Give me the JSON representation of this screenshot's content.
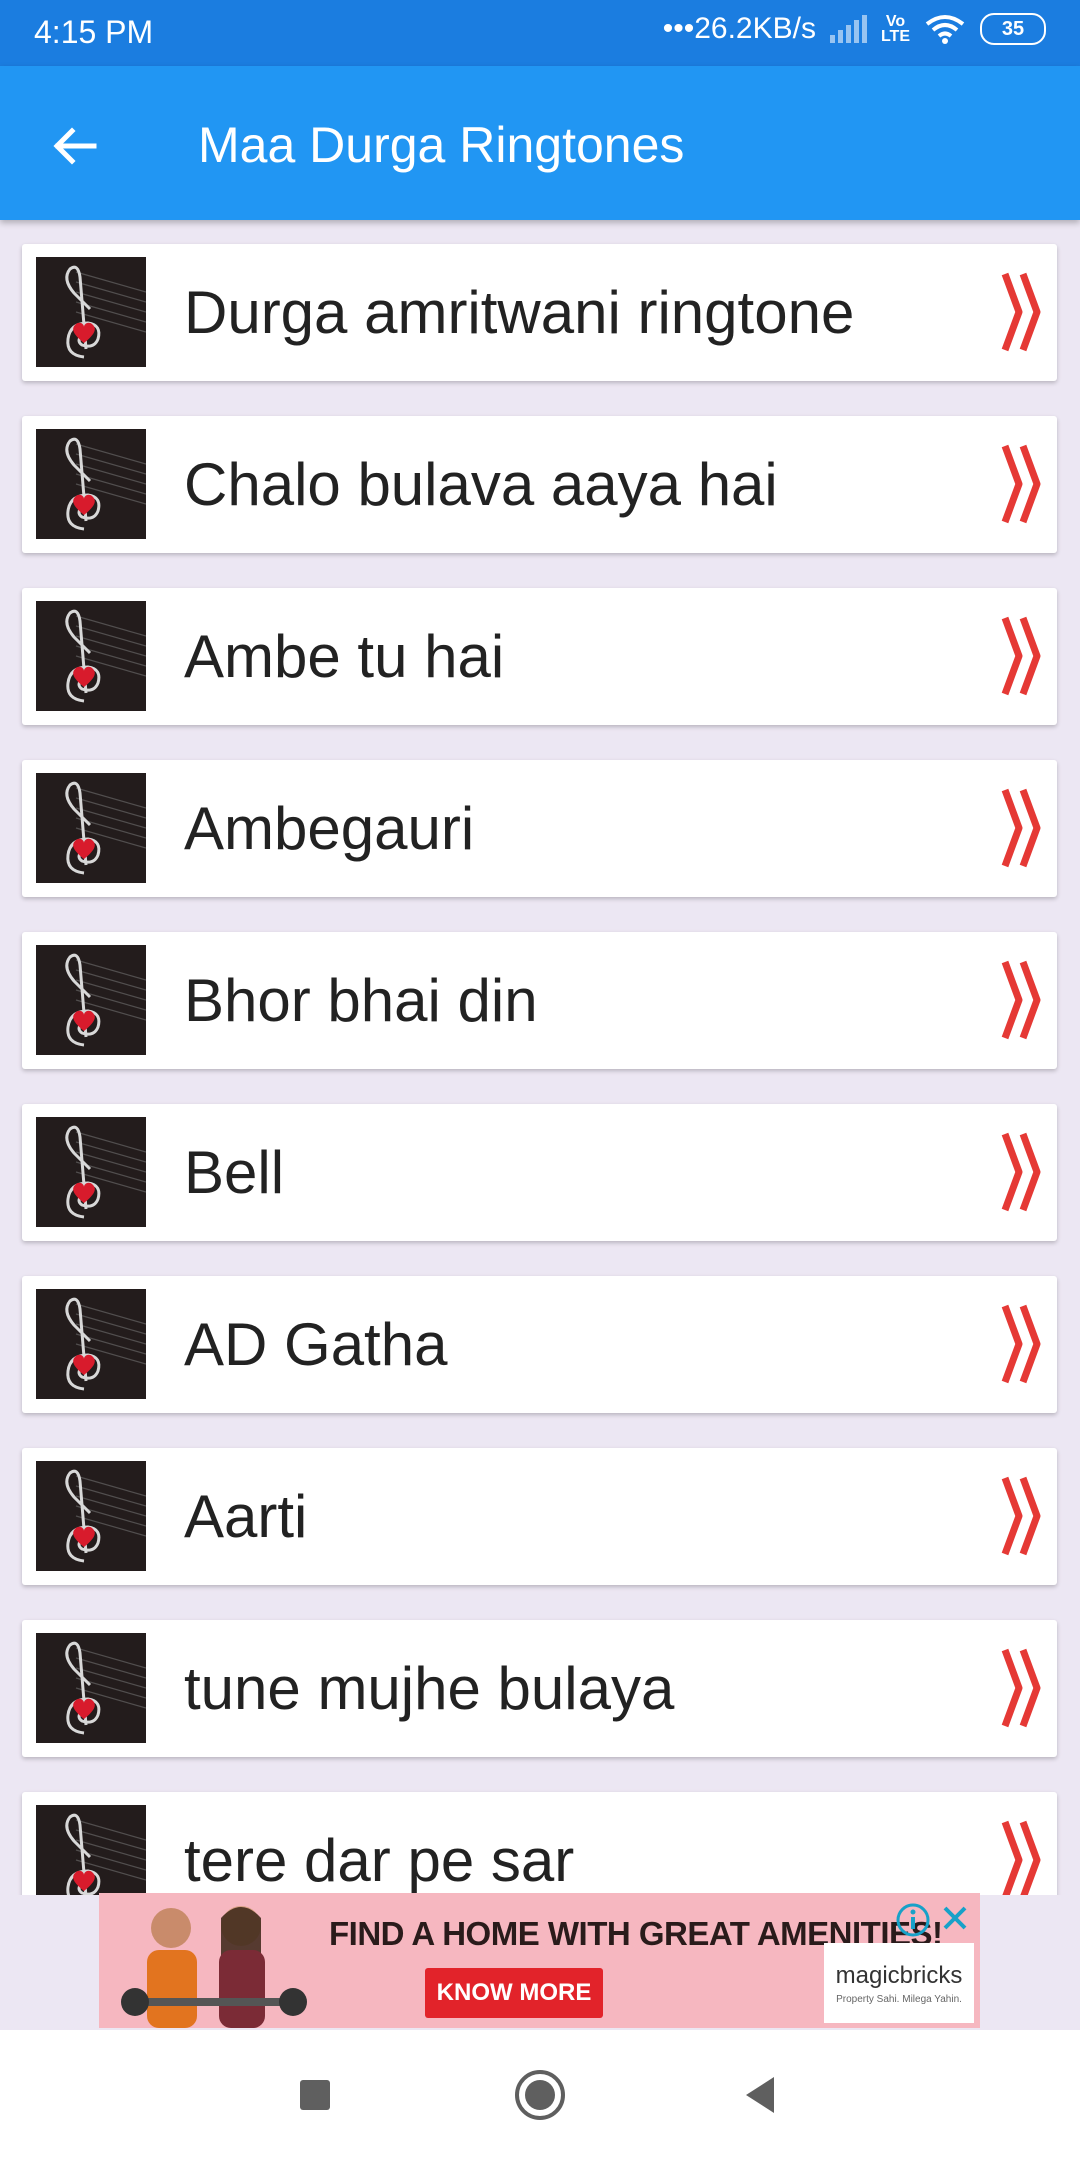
{
  "status_bar": {
    "time": "4:15 PM",
    "net_speed": "•••26.2KB/s",
    "volte_top": "Vo",
    "volte_bottom": "LTE",
    "battery": "35"
  },
  "app_bar": {
    "title": "Maa Durga Ringtones",
    "back_icon": "arrow-left-icon"
  },
  "ringtones": [
    {
      "label": "Durga amritwani ringtone"
    },
    {
      "label": "Chalo bulava aaya hai"
    },
    {
      "label": "Ambe tu hai"
    },
    {
      "label": "Ambegauri"
    },
    {
      "label": "Bhor bhai din"
    },
    {
      "label": "Bell"
    },
    {
      "label": "AD Gatha"
    },
    {
      "label": "Aarti"
    },
    {
      "label": "tune mujhe bulaya"
    },
    {
      "label": "tere dar pe sar"
    }
  ],
  "ad": {
    "headline": "FIND A HOME WITH GREAT AMENITIES!",
    "cta": "KNOW MORE",
    "brand": "magicbricks",
    "brand_tagline": "Property Sahi. Milega Yahin."
  },
  "colors": {
    "status_bar": "#1b7de0",
    "app_bar": "#2196f3",
    "background": "#ece7f3",
    "chevron": "#e53935",
    "ad_background": "#f6b7c0",
    "ad_cta": "#e2232a"
  },
  "icons": {
    "item_thumb": "treble-clef-heart-icon",
    "item_arrow": "double-chevron-right-icon",
    "nav_recents": "square-icon",
    "nav_home": "circle-icon",
    "nav_back": "triangle-back-icon"
  }
}
